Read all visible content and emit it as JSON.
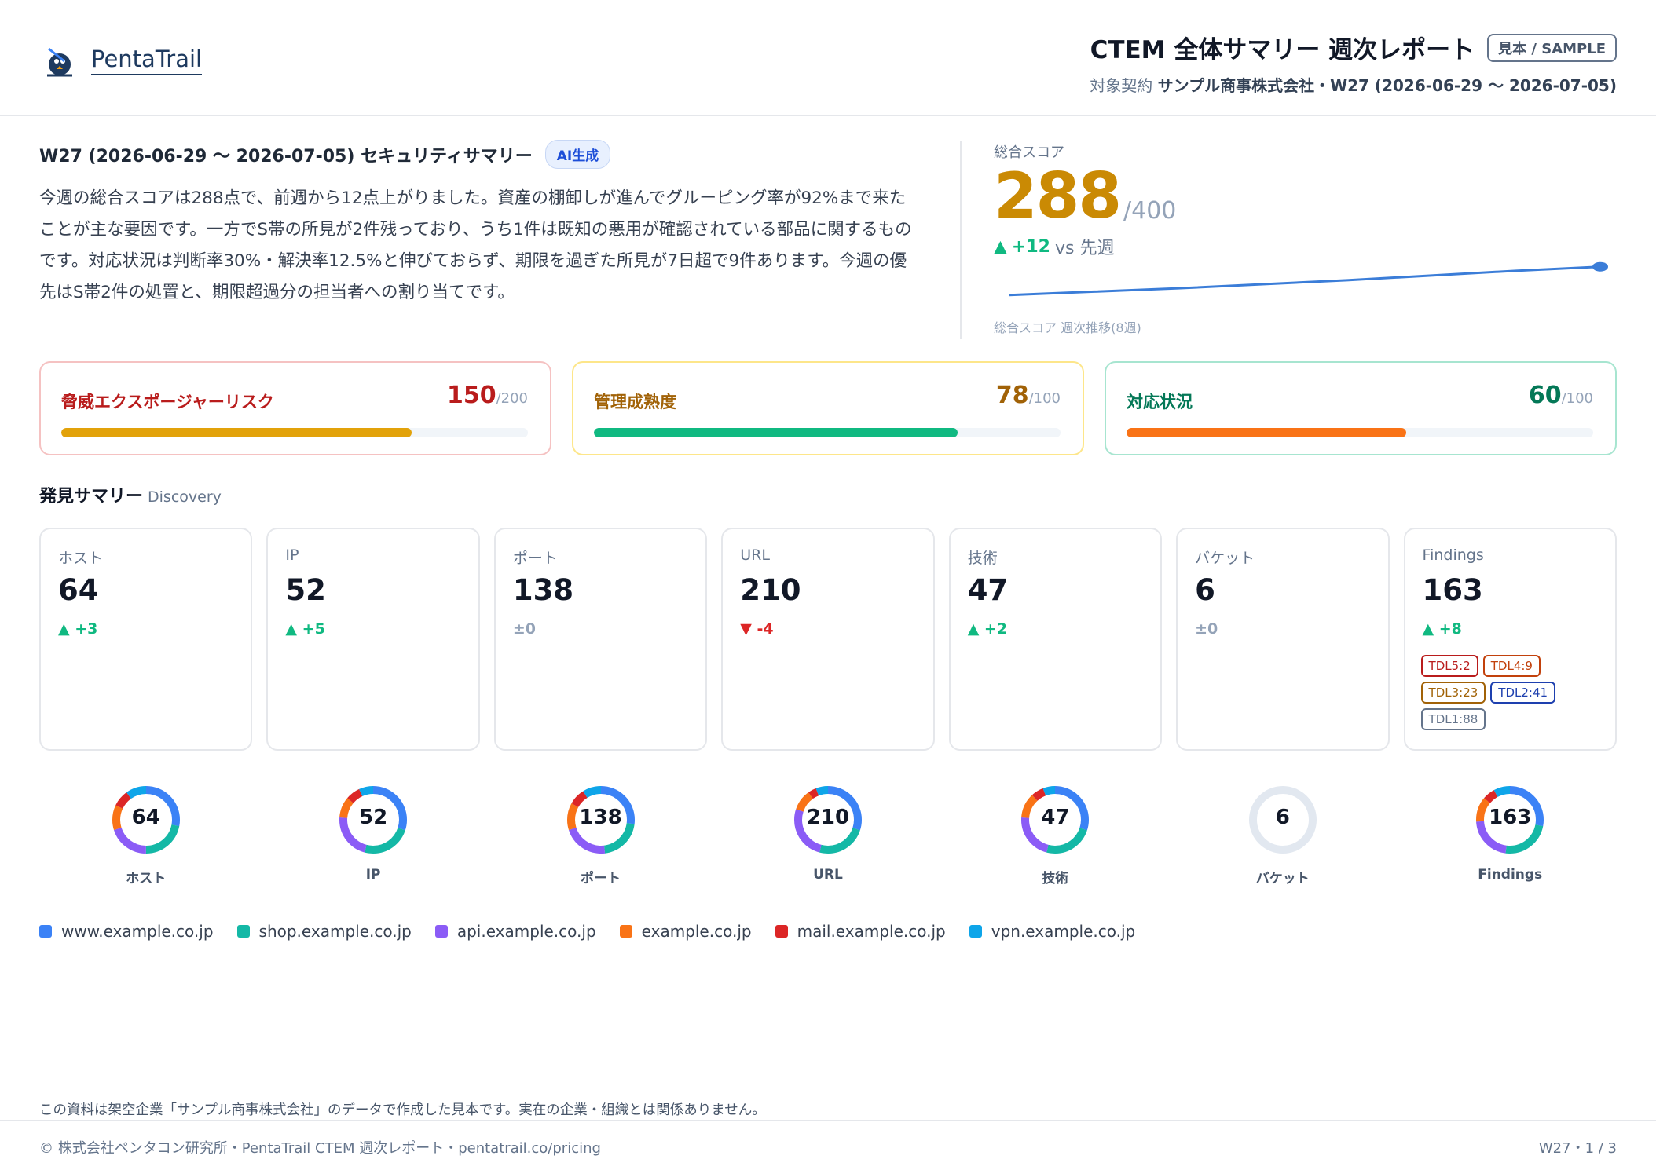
{
  "header": {
    "logo_text": "PentaTrail",
    "title": "CTEM 全体サマリー 週次レポート",
    "sample_badge": "見本 / SAMPLE",
    "contract_label": "対象契約",
    "contract_value": "サンプル商事株式会社・W27 (2026-06-29 〜 2026-07-05)"
  },
  "summary": {
    "title": "W27 (2026-06-29 〜 2026-07-05) セキュリティサマリー",
    "ai_badge": "AI生成",
    "text": "今週の総合スコアは288点で、前週から12点上がりました。資産の棚卸しが進んでグルーピング率が92%まで来たことが主な要因です。一方でS帯の所見が2件残っており、うち1件は既知の悪用が確認されている部品に関するものです。対応状況は判断率30%・解決率12.5%と伸びておらず、期限を過ぎた所見が7日超で9件あります。今週の優先はS帯2件の処置と、期限超過分の担当者への割り当てです。"
  },
  "score": {
    "label": "総合スコア",
    "value": "288",
    "max": "/400",
    "delta_arrow": "▲",
    "delta": "+12",
    "delta_suffix": "vs 先週",
    "trend_caption": "総合スコア 週次推移(8週)",
    "trend": [
      204,
      214,
      224,
      236,
      248,
      262,
      276,
      288
    ],
    "trend_color": "#3b7dd8"
  },
  "metrics": [
    {
      "name": "脅威エクスポージャーリスク",
      "value": "150",
      "max": "/200",
      "fraction": 0.75,
      "name_color": "#b91c1c",
      "border_color": "#f5c2c2",
      "fill_color": "#e2a20a"
    },
    {
      "name": "管理成熟度",
      "value": "78",
      "max": "/100",
      "fraction": 0.78,
      "name_color": "#a16207",
      "border_color": "#fde68a",
      "fill_color": "#10b981"
    },
    {
      "name": "対応状況",
      "value": "60",
      "max": "/100",
      "fraction": 0.6,
      "name_color": "#047857",
      "border_color": "#a7e5d0",
      "fill_color": "#f97316"
    }
  ],
  "discovery": {
    "title": "発見サマリー",
    "subtitle": "Discovery",
    "cards": [
      {
        "label": "ホスト",
        "value": "64",
        "delta": "▲ +3",
        "dir": "up"
      },
      {
        "label": "IP",
        "value": "52",
        "delta": "▲ +5",
        "dir": "up"
      },
      {
        "label": "ポート",
        "value": "138",
        "delta": "±0",
        "dir": "flat"
      },
      {
        "label": "URL",
        "value": "210",
        "delta": "▼ -4",
        "dir": "down"
      },
      {
        "label": "技術",
        "value": "47",
        "delta": "▲ +2",
        "dir": "up"
      },
      {
        "label": "バケット",
        "value": "6",
        "delta": "±0",
        "dir": "flat"
      },
      {
        "label": "Findings",
        "value": "163",
        "delta": "▲ +8",
        "dir": "up"
      }
    ],
    "tdl": [
      {
        "text": "TDL5:2",
        "color": "#b91c1c"
      },
      {
        "text": "TDL4:9",
        "color": "#c2410c"
      },
      {
        "text": "TDL3:23",
        "color": "#a16207"
      },
      {
        "text": "TDL2:41",
        "color": "#1e40af"
      },
      {
        "text": "TDL1:88",
        "color": "#64748b"
      }
    ]
  },
  "donuts": [
    {
      "label": "ホスト",
      "center": "64",
      "segments": [
        0.28,
        0.22,
        0.2,
        0.12,
        0.08,
        0.1
      ]
    },
    {
      "label": "IP",
      "center": "52",
      "segments": [
        0.3,
        0.24,
        0.22,
        0.1,
        0.07,
        0.07
      ]
    },
    {
      "label": "ポート",
      "center": "138",
      "segments": [
        0.27,
        0.21,
        0.22,
        0.13,
        0.08,
        0.09
      ]
    },
    {
      "label": "URL",
      "center": "210",
      "segments": [
        0.3,
        0.24,
        0.26,
        0.1,
        0.04,
        0.06
      ]
    },
    {
      "label": "技術",
      "center": "47",
      "segments": [
        0.3,
        0.24,
        0.22,
        0.12,
        0.06,
        0.06
      ]
    },
    {
      "label": "バケット",
      "center": "6",
      "segments": []
    },
    {
      "label": "Findings",
      "center": "163",
      "segments": [
        0.28,
        0.24,
        0.22,
        0.12,
        0.06,
        0.08
      ]
    }
  ],
  "legend": [
    {
      "label": "www.example.co.jp",
      "color": "#3b82f6"
    },
    {
      "label": "shop.example.co.jp",
      "color": "#14b8a6"
    },
    {
      "label": "api.example.co.jp",
      "color": "#8b5cf6"
    },
    {
      "label": "example.co.jp",
      "color": "#f97316"
    },
    {
      "label": "mail.example.co.jp",
      "color": "#dc2626"
    },
    {
      "label": "vpn.example.co.jp",
      "color": "#0ea5e9"
    }
  ],
  "footer": {
    "disclaimer": "この資料は架空企業「サンプル商事株式会社」のデータで作成した見本です。実在の企業・組織とは関係ありません。",
    "left": "© 株式会社ペンタコン研究所・PentaTrail CTEM 週次レポート・pentatrail.co/pricing",
    "right": "W27・1 / 3"
  }
}
